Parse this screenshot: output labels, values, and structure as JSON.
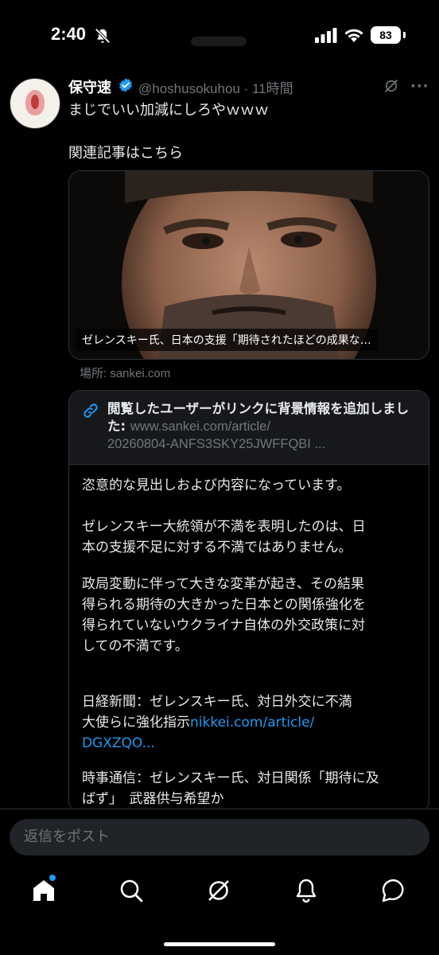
{
  "status_bar": {
    "time": "2:40",
    "battery": "83"
  },
  "post": {
    "author_name": "保守速",
    "handle_time": "@hoshusokuhou · 11時間",
    "text_line1": "まじでいい加減にしろやｗｗｗ",
    "text_line2": "関連記事はこちら",
    "card_title": "ゼレンスキー氏、日本の支援「期待されたほどの成果な…",
    "card_source": "場所: sankei.com"
  },
  "community_note": {
    "header": "閲覧したユーザーがリンクに背景情報を追加しました:",
    "header_url_line1": "www.sankei.com/article/",
    "header_url_line2": "20260804-ANFS3SKY25JWFFQBI ...",
    "p1": "恣意的な見出しおよび内容になっています。",
    "p2_line1": "ゼレンスキー大統領が不満を表明したのは、日",
    "p2_line2": "本の支援不足に対する不満ではありません。",
    "p3_line1": "政局変動に伴って大きな変革が起き、その結果",
    "p3_line2": "得られる期待の大きかった日本との関係強化を",
    "p3_line3": "得られていないウクライナ自体の外交政策に対",
    "p3_line4": "しての不満です。",
    "p4_line1": "日経新聞：ゼレンスキー氏、対日外交に不満",
    "p4_line2_text": "大使らに強化指示",
    "p4_link1": "nikkei.com/article/",
    "p4_link2": "DGXZQO...",
    "p5_line1": "時事通信：ゼレンスキー氏、対日関係「期待に及",
    "p5_line2": "ばず」　武器供与希望か"
  },
  "reply": {
    "placeholder": "返信をポスト"
  },
  "tab_bar": {
    "items": [
      "home-icon",
      "search-icon",
      "grok-icon",
      "notifications-icon",
      "messages-icon"
    ]
  },
  "colors": {
    "background": "#000000",
    "accent": "#1d9bf0",
    "muted": "#71767b",
    "border": "#2f3336"
  }
}
